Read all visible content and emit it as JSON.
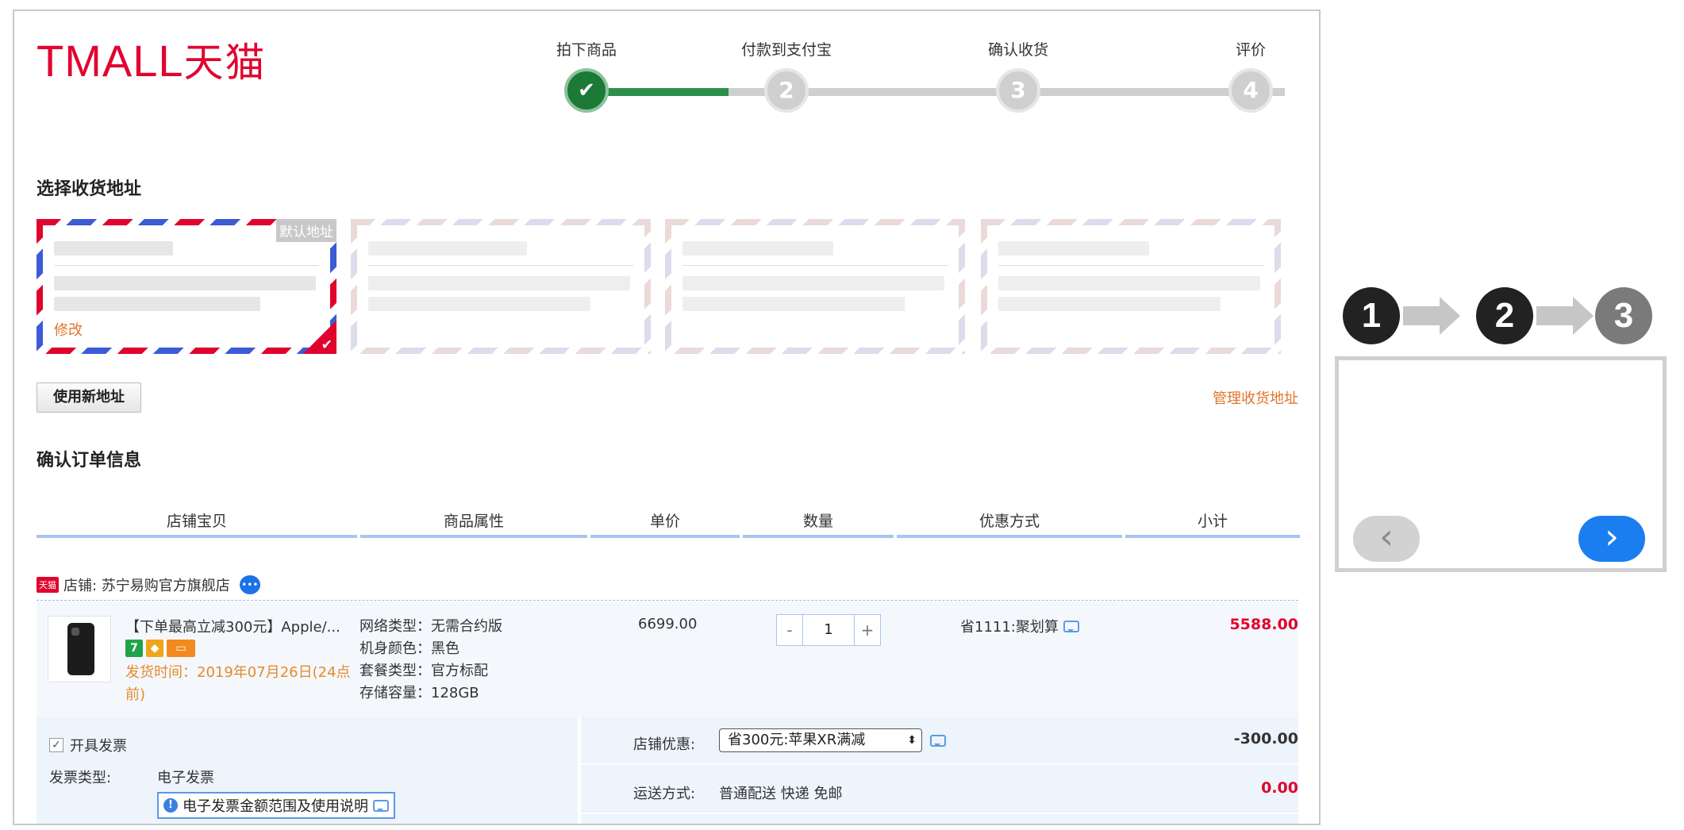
{
  "header": {
    "logo_latin": "TMALL",
    "logo_cn": "天猫"
  },
  "progress": {
    "completed_fraction": 0.22,
    "steps": [
      {
        "label": "拍下商品",
        "marker": "✔",
        "state": "done"
      },
      {
        "label": "付款到支付宝",
        "marker": "2",
        "state": "pending"
      },
      {
        "label": "确认收货",
        "marker": "3",
        "state": "pending"
      },
      {
        "label": "评价",
        "marker": "4",
        "state": "pending"
      }
    ]
  },
  "address_section": {
    "title": "选择收货地址",
    "default_badge": "默认地址",
    "edit_link": "修改",
    "new_address_button": "使用新地址",
    "manage_link": "管理收货地址"
  },
  "order_section": {
    "title": "确认订单信息",
    "columns": [
      "店铺宝贝",
      "商品属性",
      "单价",
      "数量",
      "优惠方式",
      "小计"
    ],
    "shop_tag": "天猫",
    "shop_name": "店铺: 苏宁易购官方旗舰店",
    "item": {
      "title": "【下单最高立减300元】Apple/...",
      "ship_time": "发货时间：2019年07月26日(24点前)",
      "attributes": [
        "网络类型：无需合约版",
        "机身颜色：黑色",
        "套餐类型：官方标配",
        "存储容量：128GB"
      ],
      "unit_price": "6699.00",
      "qty_minus": "-",
      "quantity": "1",
      "qty_plus": "+",
      "promotion": "省1111:聚划算",
      "subtotal": "5588.00"
    }
  },
  "invoice": {
    "check_label": "开具发票",
    "type_label": "发票类型:",
    "type_value": "电子发票",
    "note": "电子发票金额范围及使用说明"
  },
  "store_discount": {
    "label": "店铺优惠:",
    "selected": "省300元:苹果XR满减",
    "amount": "-300.00"
  },
  "shipping": {
    "label": "运送方式:",
    "value": "普通配送 快递 免邮",
    "amount": "0.00"
  },
  "side_widget": {
    "steps": [
      "1",
      "2",
      "3"
    ],
    "step_colors": [
      "#222222",
      "#222222",
      "#7a7a7a"
    ],
    "prev_label": "‹",
    "next_label": "›"
  },
  "colors": {
    "brand": "#e00531",
    "progress_done": "#1c7a36",
    "price_red": "#e0042d",
    "link_orange": "#e0742a",
    "accent_blue": "#1a7ef0"
  }
}
